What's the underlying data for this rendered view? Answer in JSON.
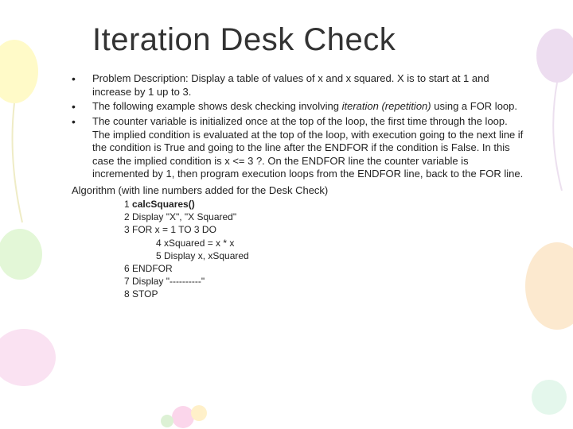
{
  "title": "Iteration Desk Check",
  "bullets": [
    "Problem Description: Display a table of values of x and x squared. X is to start at 1 and increase by 1 up to 3.",
    "The following example shows desk checking involving iteration (repetition) using a FOR loop.",
    "The counter variable is initialized once at the top of the loop, the first time through the loop. The implied condition is evaluated at the top of the loop, with execution going to the next line if the condition is True and going to the line after the ENDFOR if the condition is False. In this case the implied condition is x <= 3 ?. On the ENDFOR line the counter variable is incremented by 1, then program execution loops from the ENDFOR line, back to the FOR line."
  ],
  "italic_phrase": "iteration (repetition)",
  "algorithm_heading": "Algorithm (with line numbers added for the Desk Check)",
  "code": {
    "l1_num": "1 ",
    "l1_text": "calcSquares()",
    "l2": "2 Display \"X\", \"X Squared\"",
    "l3": "3 FOR x = 1 TO 3 DO",
    "l4": "4 xSquared = x * x",
    "l5": "5 Display x, xSquared",
    "l6": "6 ENDFOR",
    "l7": "7 Display \"----------\"",
    "l8": "8 STOP"
  }
}
